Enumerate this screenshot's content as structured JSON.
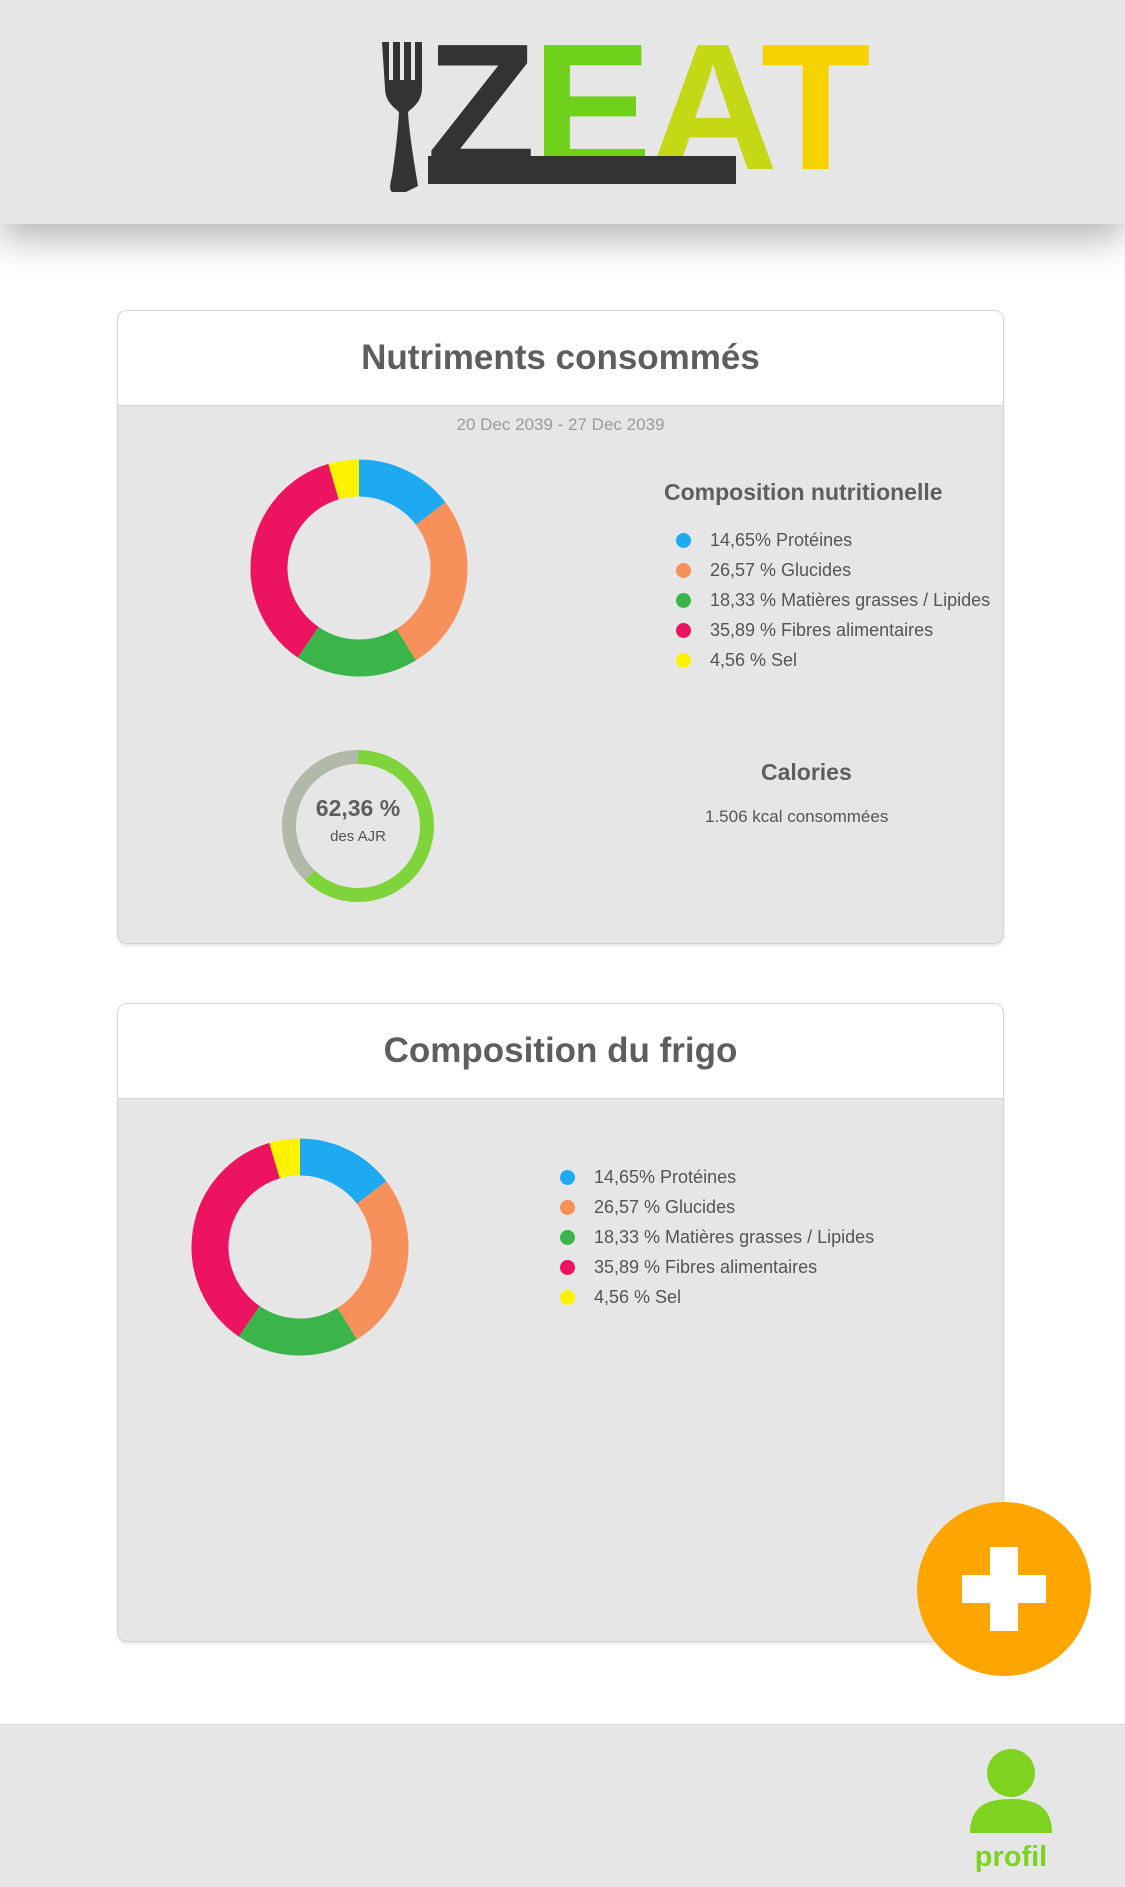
{
  "app": {
    "logo_text_z": "Z",
    "logo_text_e": "E",
    "logo_text_a": "A",
    "logo_text_t": "T",
    "logo_icon": "fork-icon"
  },
  "colors": {
    "protein": "#1eaaf0",
    "glucides": "#f7905a",
    "lipides": "#3bb54a",
    "fibres": "#ec1460",
    "sel": "#fff200",
    "calories_fill": "#7ed43a",
    "calories_rest": "#b1b9a9",
    "accent_orange": "#ffa500",
    "profile_green": "#7ed321"
  },
  "nutrients_card": {
    "title": "Nutriments consommés",
    "date_range": "20 Dec 2039 - 27 Dec 2039",
    "composition_heading": "Composition nutritionelle",
    "calories_heading": "Calories",
    "calories_text": "1.506 kcal consommées",
    "gauge_value": "62,36 %",
    "gauge_caption": "des AJR",
    "legend": [
      {
        "label": "14,65% Protéines"
      },
      {
        "label": " 26,57 % Glucides"
      },
      {
        "label": "18,33 % Matières grasses / Lipides"
      },
      {
        "label": "35,89 % Fibres alimentaires"
      },
      {
        "label": "4,56 % Sel"
      }
    ]
  },
  "fridge_card": {
    "title": "Composition du frigo",
    "legend": [
      {
        "label": "14,65% Protéines"
      },
      {
        "label": " 26,57 % Glucides"
      },
      {
        "label": "18,33 % Matières grasses / Lipides"
      },
      {
        "label": "35,89 % Fibres alimentaires"
      },
      {
        "label": "4,56 % Sel"
      }
    ]
  },
  "fab": {
    "icon": "plus-icon"
  },
  "footer": {
    "profile_label": "profil",
    "profile_icon": "user-icon"
  },
  "chart_data": [
    {
      "type": "pie",
      "categories": [
        "Protéines",
        "Glucides",
        "Matières grasses / Lipides",
        "Fibres alimentaires",
        "Sel"
      ],
      "values": [
        14.65,
        26.57,
        18.33,
        35.89,
        4.56
      ],
      "colors": [
        "#1eaaf0",
        "#f7905a",
        "#3bb54a",
        "#ec1460",
        "#fff200"
      ]
    },
    {
      "type": "pie",
      "categories": [
        "des AJR",
        ""
      ],
      "values": [
        62.36,
        37.64
      ],
      "colors": [
        "#7ed43a",
        "#b1b9a9"
      ]
    },
    {
      "type": "pie",
      "categories": [
        "Protéines",
        "Glucides",
        "Matières grasses / Lipides",
        "Fibres alimentaires",
        "Sel"
      ],
      "values": [
        14.65,
        26.57,
        18.33,
        35.89,
        4.56
      ],
      "colors": [
        "#1eaaf0",
        "#f7905a",
        "#3bb54a",
        "#ec1460",
        "#fff200"
      ]
    }
  ]
}
